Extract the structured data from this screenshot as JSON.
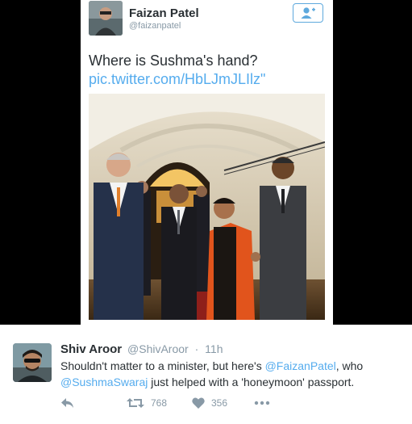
{
  "embedded_tweet": {
    "author_name": "Faizan Patel",
    "author_handle": "@faizanpatel",
    "text": "Where is Sushma's hand?",
    "link": "pic.twitter.com/HbLJmJLIlz\""
  },
  "tweet": {
    "author_name": "Shiv Aroor",
    "author_handle": "@ShivAroor",
    "separator": "·",
    "time": "11h",
    "body": {
      "part1": "Shouldn't matter to a minister, but here's ",
      "mention1": "@FaizanPatel",
      "part2": ", who ",
      "mention2": "@SushmaSwaraj",
      "part3": " just helped with a 'honeymoon' passport."
    },
    "retweet_count": "768",
    "like_count": "356"
  },
  "colors": {
    "accent": "#55acee",
    "text": "#292f33",
    "muted": "#8899a6"
  }
}
